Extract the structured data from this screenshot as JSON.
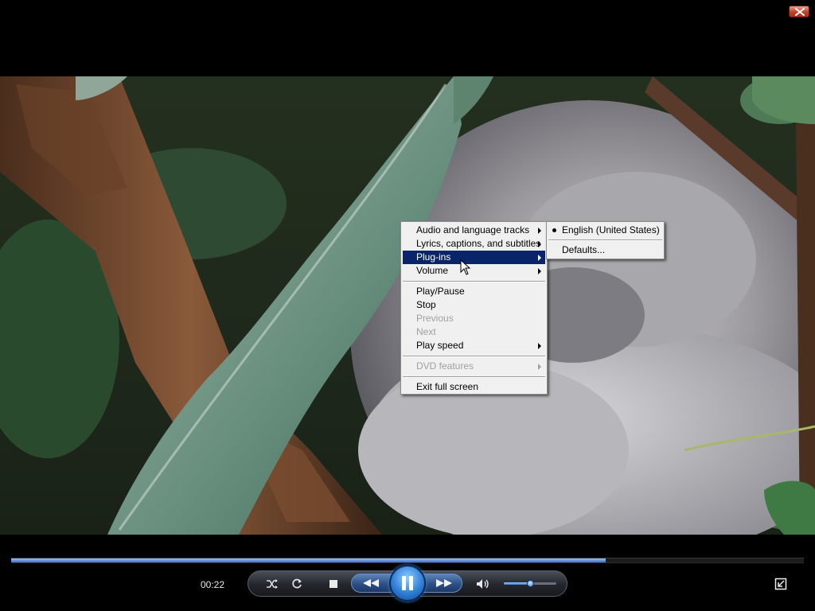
{
  "window": {
    "close_icon": "close-icon"
  },
  "context_menu": {
    "items": [
      {
        "label": "Audio and language tracks",
        "submenu": true,
        "enabled": true
      },
      {
        "label": "Lyrics, captions, and subtitles",
        "submenu": true,
        "enabled": true
      },
      {
        "label": "Plug-ins",
        "submenu": true,
        "enabled": true,
        "highlighted": true
      },
      {
        "label": "Volume",
        "submenu": true,
        "enabled": true
      },
      {
        "label": "Play/Pause",
        "submenu": false,
        "enabled": true
      },
      {
        "label": "Stop",
        "submenu": false,
        "enabled": true
      },
      {
        "label": "Previous",
        "submenu": false,
        "enabled": false
      },
      {
        "label": "Next",
        "submenu": false,
        "enabled": false
      },
      {
        "label": "Play speed",
        "submenu": true,
        "enabled": true
      },
      {
        "label": "DVD features",
        "submenu": true,
        "enabled": false
      },
      {
        "label": "Exit full screen",
        "submenu": false,
        "enabled": true
      }
    ],
    "submenu": {
      "items": [
        {
          "label": "English (United States)",
          "selected": true
        },
        {
          "label": "Defaults..."
        }
      ]
    }
  },
  "player": {
    "elapsed_time": "00:22",
    "seek_progress_fraction": 0.75,
    "volume_fraction": 0.5,
    "state": "playing"
  },
  "colors": {
    "menu_highlight": "#0a246a",
    "menu_background": "#f0f0f0",
    "seek_fill": "#3c6cc6",
    "accent_blue": "#2f7fd8"
  }
}
